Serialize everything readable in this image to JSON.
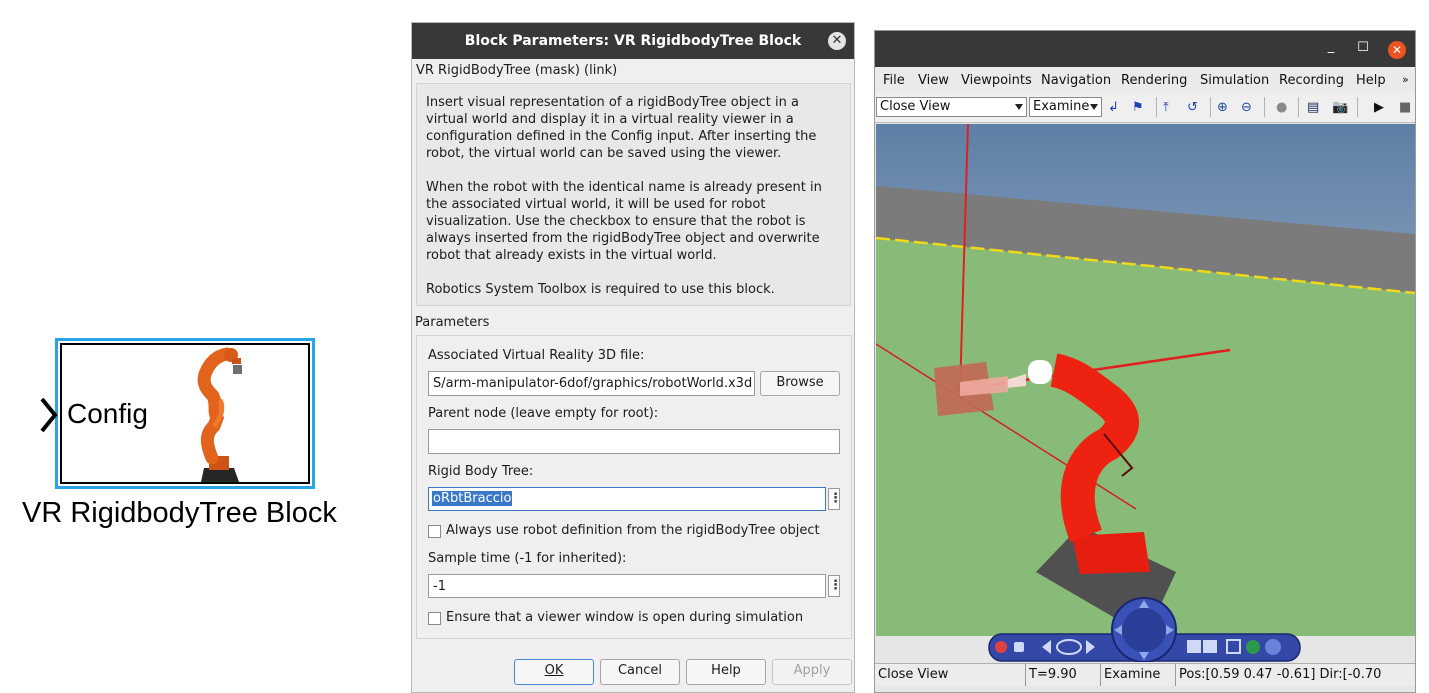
{
  "block": {
    "port_label": "Config",
    "name": "VR RigidbodyTree Block"
  },
  "dialog": {
    "title": "Block Parameters: VR RigidbodyTree Block",
    "close_icon": "close-icon",
    "mask_label": "VR RigidBodyTree (mask) (link)",
    "description": [
      "Insert visual representation of a rigidBodyTree object in a",
      "virtual world and display it in a virtual reality viewer in a",
      "configuration defined in the Config input. After inserting the",
      "robot, the virtual world can be saved using the viewer.",
      "",
      "When the robot with the identical name is already present in",
      "the associated virtual world, it will be used for robot",
      "visualization. Use the checkbox to ensure that the robot is",
      "always inserted from the rigidBodyTree object and overwrite",
      "robot that already exists in the virtual world.",
      "",
      "Robotics System Toolbox is required to use this block."
    ],
    "parameters_label": "Parameters",
    "vr_file_label": "Associated Virtual Reality 3D file:",
    "vr_file_value": "S/arm-manipulator-6dof/graphics/robotWorld.x3d",
    "browse_label": "Browse",
    "parent_node_label": "Parent node (leave empty for root):",
    "parent_node_value": "",
    "rigid_body_tree_label": "Rigid Body Tree:",
    "rigid_body_tree_value": "oRbtBraccio",
    "always_use_label": "Always use robot definition from the rigidBodyTree object",
    "always_use_checked": false,
    "sample_time_label": "Sample time (-1 for inherited):",
    "sample_time_value": "-1",
    "ensure_viewer_label": "Ensure that a viewer window is open during simulation",
    "ensure_viewer_checked": false,
    "buttons": {
      "ok": "OK",
      "cancel": "Cancel",
      "help": "Help",
      "apply": "Apply"
    }
  },
  "viewer": {
    "menu": [
      "File",
      "View",
      "Viewpoints",
      "Navigation",
      "Rendering",
      "Simulation",
      "Recording",
      "Help"
    ],
    "viewpoint_combo": "Close View",
    "navigation_combo": "Examine",
    "status": {
      "viewpoint": "Close View",
      "time": "T=9.90",
      "mode": "Examine",
      "pos_dir": "Pos:[0.59 0.47 -0.61] Dir:[-0.70"
    },
    "colors": {
      "sky_top": "#5e7fa6",
      "sky_bottom": "#c7d4e3",
      "floor": "#88bb77",
      "road": "#7b7b7b",
      "robot": "#ee2211",
      "title_bar": "#383838",
      "close_button": "#e95420"
    }
  },
  "colors": {
    "block_highlight": "#2aa3e8",
    "robot_orange": "#e2631b",
    "selection_blue": "#3a78c9"
  }
}
